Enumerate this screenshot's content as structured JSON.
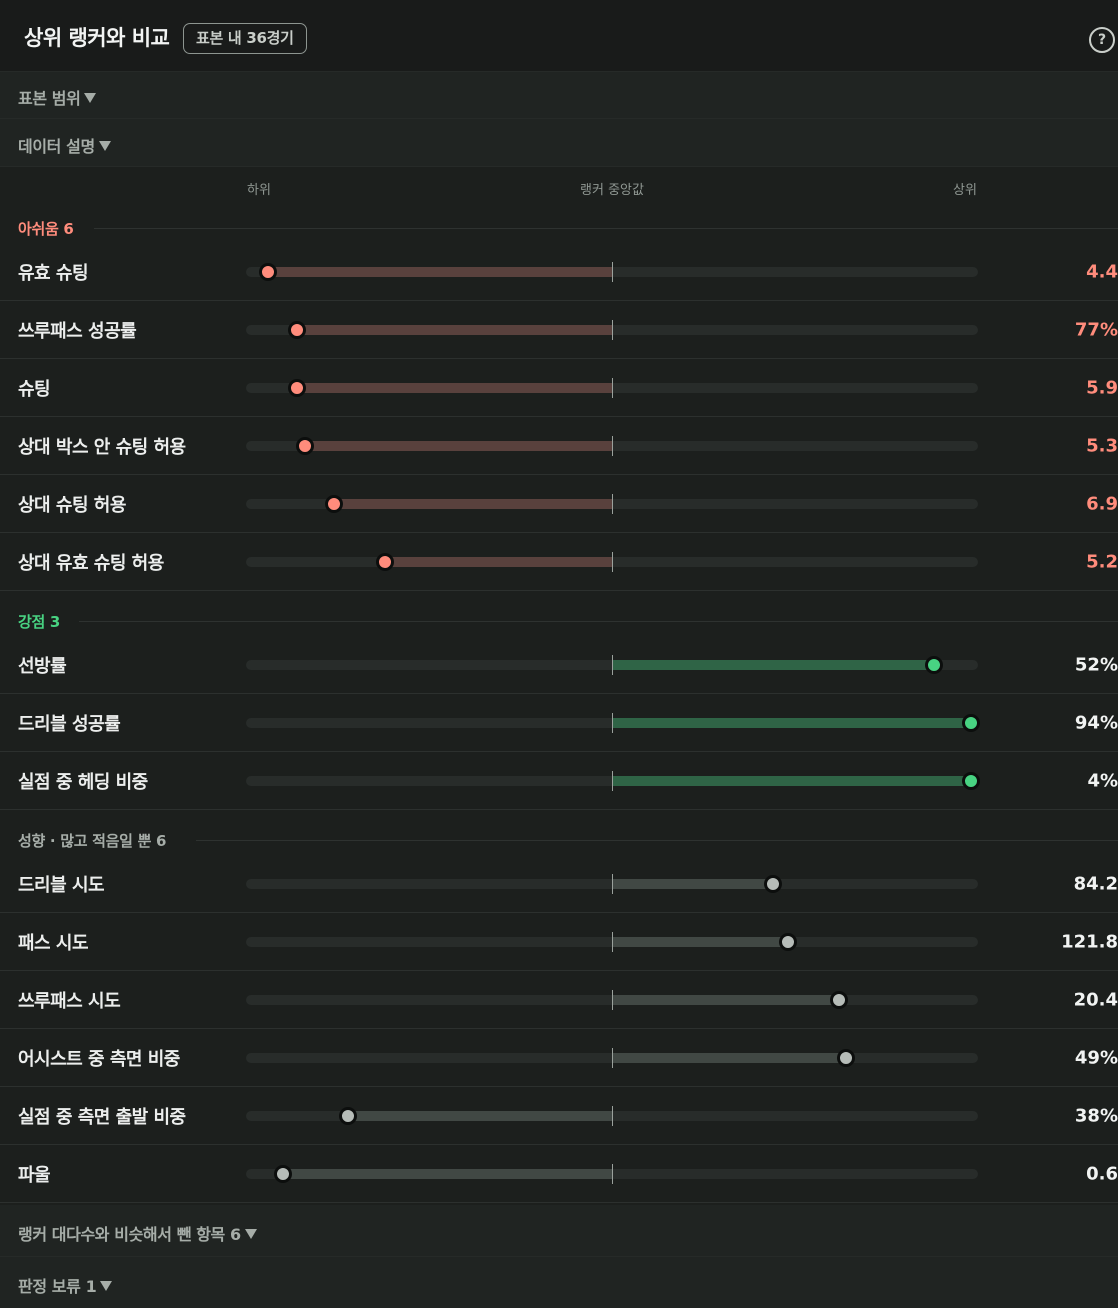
{
  "header": {
    "title": "상위 랭커와 비교",
    "badge": "표본 내 36경기",
    "help_symbol": "?"
  },
  "sample_range": {
    "label": "표본 범위"
  },
  "data_description": {
    "label": "데이터 설명"
  },
  "scale": {
    "low": "하위",
    "mid": "랭커 중앙값",
    "high": "상위"
  },
  "sections": {
    "weak": {
      "title": "아쉬움 6",
      "color": "#ff8c7c",
      "rows": [
        {
          "label": "유효 슈팅",
          "value": "4.4",
          "position": 0.03
        },
        {
          "label": "쓰루패스 성공률",
          "value": "77%",
          "position": 0.07
        },
        {
          "label": "슈팅",
          "value": "5.9",
          "position": 0.07
        },
        {
          "label": "상대 박스 안 슈팅 허용",
          "value": "5.3",
          "position": 0.08
        },
        {
          "label": "상대 슈팅 허용",
          "value": "6.9",
          "position": 0.12
        },
        {
          "label": "상대 유효 슈팅 허용",
          "value": "5.2",
          "position": 0.19
        }
      ]
    },
    "strong": {
      "title": "강점 3",
      "color": "#48d382",
      "rows": [
        {
          "label": "선방률",
          "value": "52%",
          "position": 0.94
        },
        {
          "label": "드리블 성공률",
          "value": "94%",
          "position": 0.99
        },
        {
          "label": "실점 중 헤딩 비중",
          "value": "4%",
          "position": 0.99
        }
      ]
    },
    "style": {
      "title": "성향 · 많고 적음일 뿐 6",
      "color": "#a6ada8",
      "rows": [
        {
          "label": "드리블 시도",
          "value": "84.2",
          "position": 0.72
        },
        {
          "label": "패스 시도",
          "value": "121.8",
          "position": 0.74
        },
        {
          "label": "쓰루패스 시도",
          "value": "20.4",
          "position": 0.81
        },
        {
          "label": "어시스트 중 측면 비중",
          "value": "49%",
          "position": 0.82
        },
        {
          "label": "실점 중 측면 출발 비중",
          "value": "38%",
          "position": 0.14
        },
        {
          "label": "파울",
          "value": "0.6",
          "position": 0.05
        }
      ]
    }
  },
  "footer": {
    "similar_items": {
      "label": "랭커 대다수와 비슷해서 뺀 항목 6"
    },
    "pending": {
      "label": "판정 보류 1"
    }
  }
}
